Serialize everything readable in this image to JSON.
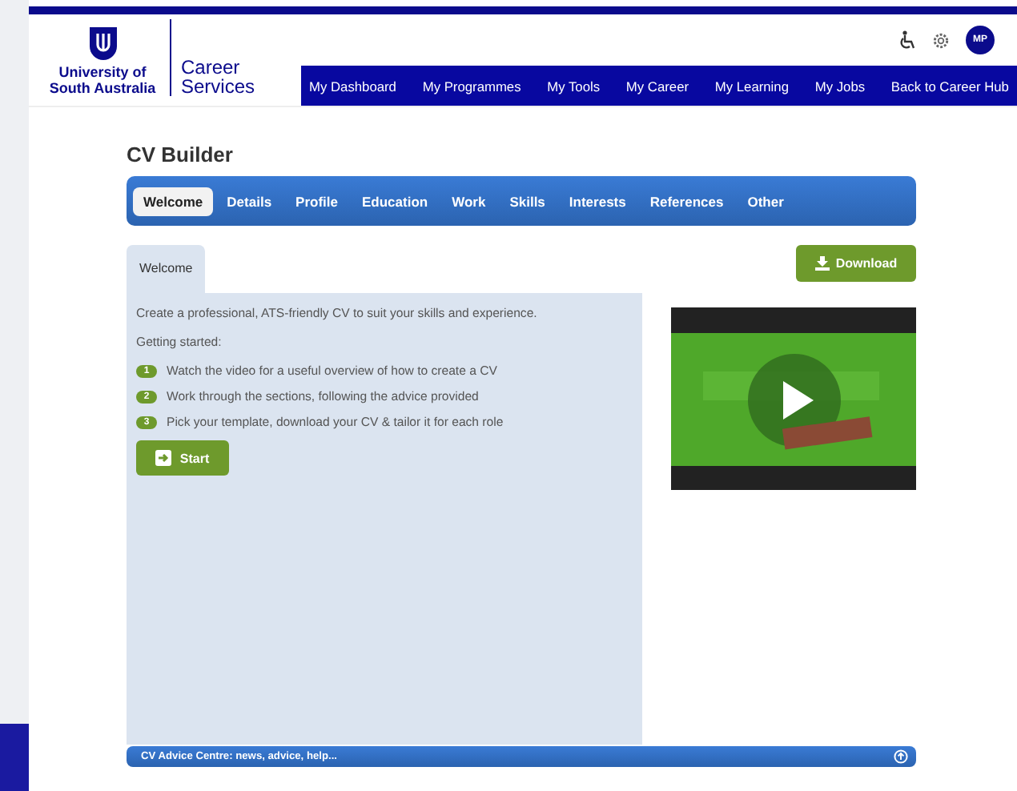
{
  "logo": {
    "university": "University of South Australia",
    "service_line1": "Career",
    "service_line2": "Services"
  },
  "user": {
    "initials": "MP"
  },
  "nav": [
    "My Dashboard",
    "My Programmes",
    "My Tools",
    "My Career",
    "My Learning",
    "My Jobs",
    "Back to Career Hub"
  ],
  "page_title": "CV Builder",
  "tabs": [
    {
      "label": "Welcome",
      "selected": true
    },
    {
      "label": "Details",
      "selected": false
    },
    {
      "label": "Profile",
      "selected": false
    },
    {
      "label": "Education",
      "selected": false
    },
    {
      "label": "Work",
      "selected": false
    },
    {
      "label": "Skills",
      "selected": false
    },
    {
      "label": "Interests",
      "selected": false
    },
    {
      "label": "References",
      "selected": false
    },
    {
      "label": "Other",
      "selected": false
    }
  ],
  "panel_tab": "Welcome",
  "download_button": "Download",
  "intro": "Create a professional, ATS-friendly CV to suit your skills and experience.",
  "getting_started": "Getting started:",
  "steps": [
    {
      "number": "1",
      "text": "Watch the video for a useful overview of how to create a CV"
    },
    {
      "number": "2",
      "text": "Work through the sections, following the advice provided"
    },
    {
      "number": "3",
      "text": "Pick your template, download your CV & tailor it for each role"
    }
  ],
  "start_button": "Start",
  "footer_bar": "CV Advice Centre: news, advice, help..."
}
